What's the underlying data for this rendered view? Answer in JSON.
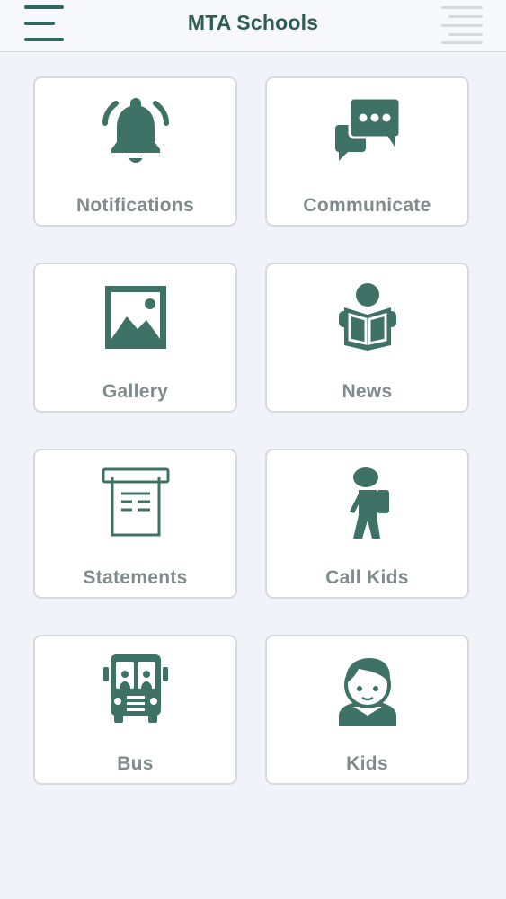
{
  "header": {
    "title": "MTA Schools",
    "menu_icon": "hamburger-menu-icon",
    "right_icon": "list-menu-icon"
  },
  "tiles": [
    {
      "label": "Notifications",
      "icon": "bell-icon"
    },
    {
      "label": "Communicate",
      "icon": "chat-bubbles-icon"
    },
    {
      "label": "Gallery",
      "icon": "image-icon"
    },
    {
      "label": "News",
      "icon": "reading-person-icon"
    },
    {
      "label": "Statements",
      "icon": "receipt-icon"
    },
    {
      "label": "Call Kids",
      "icon": "walking-student-icon"
    },
    {
      "label": "Bus",
      "icon": "school-bus-icon"
    },
    {
      "label": "Kids",
      "icon": "boy-face-icon"
    }
  ],
  "colors": {
    "accent": "#3f7267",
    "title": "#2f5c56",
    "label": "#808b8b",
    "background": "#f1f3f9",
    "tile_border": "#d7dadd"
  }
}
